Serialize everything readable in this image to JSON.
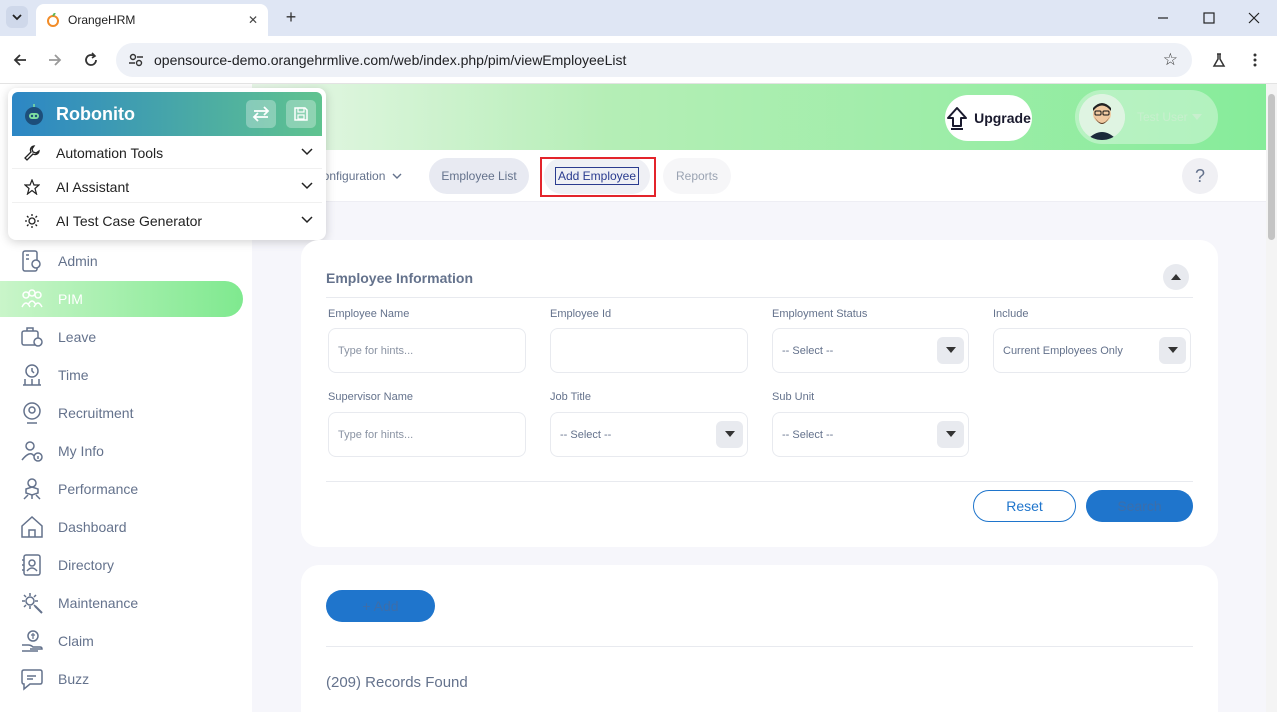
{
  "browser": {
    "tab_title": "OrangeHRM",
    "url": "opensource-demo.orangehrmlive.com/web/index.php/pim/viewEmployeeList"
  },
  "header": {
    "upgrade_label": "Upgrade",
    "user_name": "Test User"
  },
  "topnav": {
    "items": [
      {
        "label": "Configuration"
      },
      {
        "label": "Employee List"
      },
      {
        "label": "Add Employee"
      },
      {
        "label": "Reports"
      }
    ],
    "help_label": "?"
  },
  "robonito": {
    "title": "Robonito",
    "rows": [
      {
        "label": "Automation Tools"
      },
      {
        "label": "AI Assistant"
      },
      {
        "label": "AI Test Case Generator"
      }
    ]
  },
  "sidebar": {
    "items": [
      {
        "label": "Admin"
      },
      {
        "label": "PIM"
      },
      {
        "label": "Leave"
      },
      {
        "label": "Time"
      },
      {
        "label": "Recruitment"
      },
      {
        "label": "My Info"
      },
      {
        "label": "Performance"
      },
      {
        "label": "Dashboard"
      },
      {
        "label": "Directory"
      },
      {
        "label": "Maintenance"
      },
      {
        "label": "Claim"
      },
      {
        "label": "Buzz"
      }
    ]
  },
  "filter": {
    "title": "Employee Information",
    "employee_name": {
      "label": "Employee Name",
      "placeholder": "Type for hints..."
    },
    "employee_id": {
      "label": "Employee Id",
      "value": ""
    },
    "employment_status": {
      "label": "Employment Status",
      "value": "-- Select --"
    },
    "include": {
      "label": "Include",
      "value": "Current Employees Only"
    },
    "supervisor_name": {
      "label": "Supervisor Name",
      "placeholder": "Type for hints..."
    },
    "job_title": {
      "label": "Job Title",
      "value": "-- Select --"
    },
    "sub_unit": {
      "label": "Sub Unit",
      "value": "-- Select --"
    },
    "reset_label": "Reset",
    "search_label": "Search"
  },
  "list": {
    "add_label": "+ Add",
    "records_found": "(209) Records Found"
  }
}
